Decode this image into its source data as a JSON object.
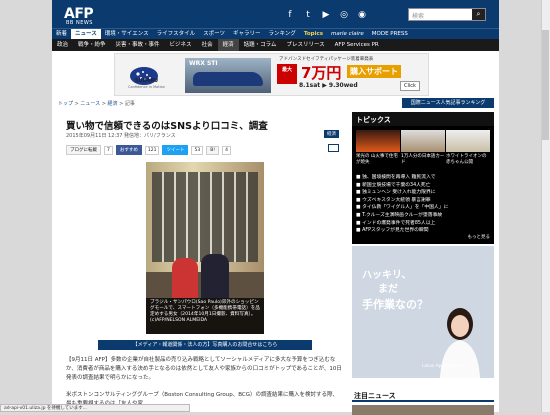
{
  "header": {
    "logo": "AFP",
    "subtitle": "BB NEWS",
    "search_placeholder": "検索",
    "social_icons": [
      "facebook-icon",
      "twitter-icon",
      "youtube-icon",
      "instagram-icon",
      "rss-icon"
    ]
  },
  "nav_primary": [
    {
      "label": "新着",
      "active": false
    },
    {
      "label": "ニュース",
      "active": true
    },
    {
      "label": "環境・サイエンス",
      "active": false
    },
    {
      "label": "ライフスタイル",
      "active": false
    },
    {
      "label": "スポーツ",
      "active": false
    },
    {
      "label": "ギャラリー",
      "active": false
    },
    {
      "label": "ランキング",
      "active": false
    },
    {
      "label": "Topics",
      "active": false
    },
    {
      "label": "marie claire",
      "active": false
    },
    {
      "label": "MODE PRESS",
      "active": false
    }
  ],
  "nav_secondary": [
    {
      "label": "政治",
      "active": false
    },
    {
      "label": "戦争・紛争",
      "active": false
    },
    {
      "label": "災害・事故・事件",
      "active": false
    },
    {
      "label": "ビジネス",
      "active": false
    },
    {
      "label": "社会",
      "active": false
    },
    {
      "label": "経済",
      "active": true
    },
    {
      "label": "話題・コラム",
      "active": false
    },
    {
      "label": "プレスリリース",
      "active": false
    },
    {
      "label": "AFP Services PR",
      "active": false
    }
  ],
  "ad": {
    "brand": "SUBARU",
    "tagline": "Confidence in Motion",
    "model": "WRX STI",
    "fair": "アドバンスドセイフティパッケージ装着車発表",
    "badge": "最大",
    "price": "7万円",
    "support": "購入サポート",
    "date": "8.1sat ▶ 9.30wed",
    "click": "Click"
  },
  "breadcrumb": [
    "トップ",
    "ニュース",
    "経済",
    "記事"
  ],
  "ranking_button": "国際ニュース人気記事ランキング",
  "article": {
    "title": "買い物で信頼できるのはSNSより口コミ、調査",
    "meta": "2015年09月11日 12:37 発信地：パリ/フランス",
    "category": "経済",
    "share": [
      {
        "label": "ブログに転載",
        "count": "7"
      },
      {
        "label": "おすすめ",
        "count": "121"
      },
      {
        "label": "ツイート",
        "count": "53"
      },
      {
        "label": "",
        "count": "4"
      }
    ],
    "photo_caption": "ブラジル・サンパウロ(Sao Paulo)郊外のショッピングモールで、スマートフォン（多機能携帯電話）を品定めする男女（2014年10月1日撮影、資料写真）。(c)AFP/NELSON ALMEIDA",
    "photo_banner": "【メディア・報道関係・法人の方】写真購入のお問合せはこちら",
    "body_1": "【9月11日 AFP】多数の企業が自社製品の売り込み戦略としてソーシャルメディアに多大な予算をつぎ込むなか、消費者が商品を購入する決め手となるのは依然として友人や家族からの口コミがトップであることが、10日発表の調査結果で明らかになった。",
    "body_2": "米ボストンコンサルティンググループ（Boston Consulting Group、BCG）の調査結果に購入を検討する際、最も重要視するのは「友人や家"
  },
  "sidebar": {
    "topics_title": "トピックス",
    "tiles": [
      {
        "text": "栄光の 山火事で住宅が焼失"
      },
      {
        "text": "1万人分の日本語カード"
      },
      {
        "text": "ホワイトライオンの赤ちゃん公開"
      }
    ],
    "topics": [
      "独、国境検問を再導入 難民流入で",
      "新国立競技場で千葉の34人死亡",
      "独ミュンヘン 受け入れ能力限界に",
      "ウズベキスタン大統領 暴言謝罪",
      "タイ仏教「ワイグル人」を「中国人」に",
      "T.クルーズ主演映画クルーが墜落事故",
      "インドの爆発事件で死者85人以上",
      "AFPスタッフが見た世界の瞬間"
    ],
    "topics_more": "もっと見る",
    "ad2_line1": "ハッキリ、",
    "ad2_line2": "まだ",
    "ad2_line3": "手作業なの？",
    "ad2_brand": "Lotus Applications",
    "news_title": "注目ニュース"
  },
  "status_bar": "ad-api-v01.uliza.jp を待機しています...",
  "colors": {
    "brand_navy": "#0a3a6e",
    "nav_dark": "#1a1a1a",
    "accent_red": "#cc0000"
  }
}
